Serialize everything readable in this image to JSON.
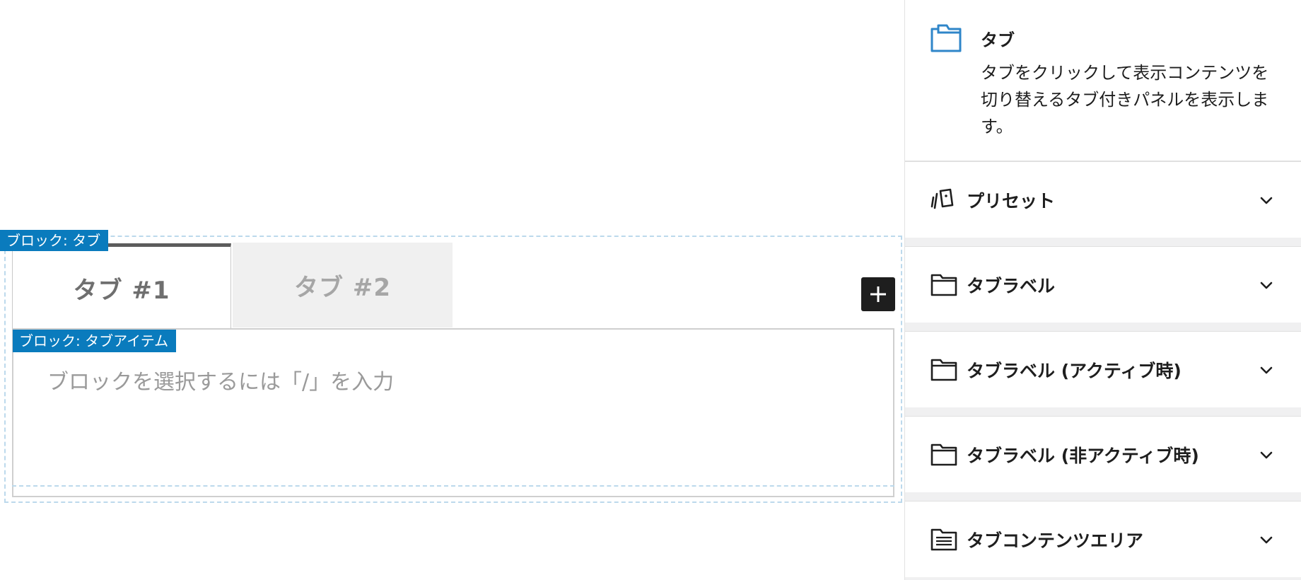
{
  "canvas": {
    "tabs_block_label": "ブロック: タブ",
    "tab_item_label": "ブロック: タブアイテム",
    "tabs": [
      {
        "label": "タブ #1",
        "active": true
      },
      {
        "label": "タブ #2",
        "active": false
      }
    ],
    "add_tab_symbol": "+",
    "placeholder": "ブロックを選択するには「/」を入力"
  },
  "sidebar": {
    "block_card": {
      "title": "タブ",
      "description": "タブをクリックして表示コンテンツを切り替えるタブ付きパネルを表示します。",
      "icon": "folder-tab-icon"
    },
    "sections": [
      {
        "title": "プリセット",
        "icon": "preset-cards-icon"
      },
      {
        "title": "タブラベル",
        "icon": "folder-icon"
      },
      {
        "title": "タブラベル (アクティブ時)",
        "icon": "folder-icon"
      },
      {
        "title": "タブラベル (非アクティブ時)",
        "icon": "folder-icon"
      },
      {
        "title": "タブコンテンツエリア",
        "icon": "document-list-icon"
      }
    ]
  },
  "colors": {
    "accent": "#0a7bbd",
    "block_outline": "#bcd9ec",
    "icon_blue": "#2f86c9",
    "active_tab_text": "#6f6f6f",
    "inactive_tab_bg": "#f0f0f0"
  }
}
